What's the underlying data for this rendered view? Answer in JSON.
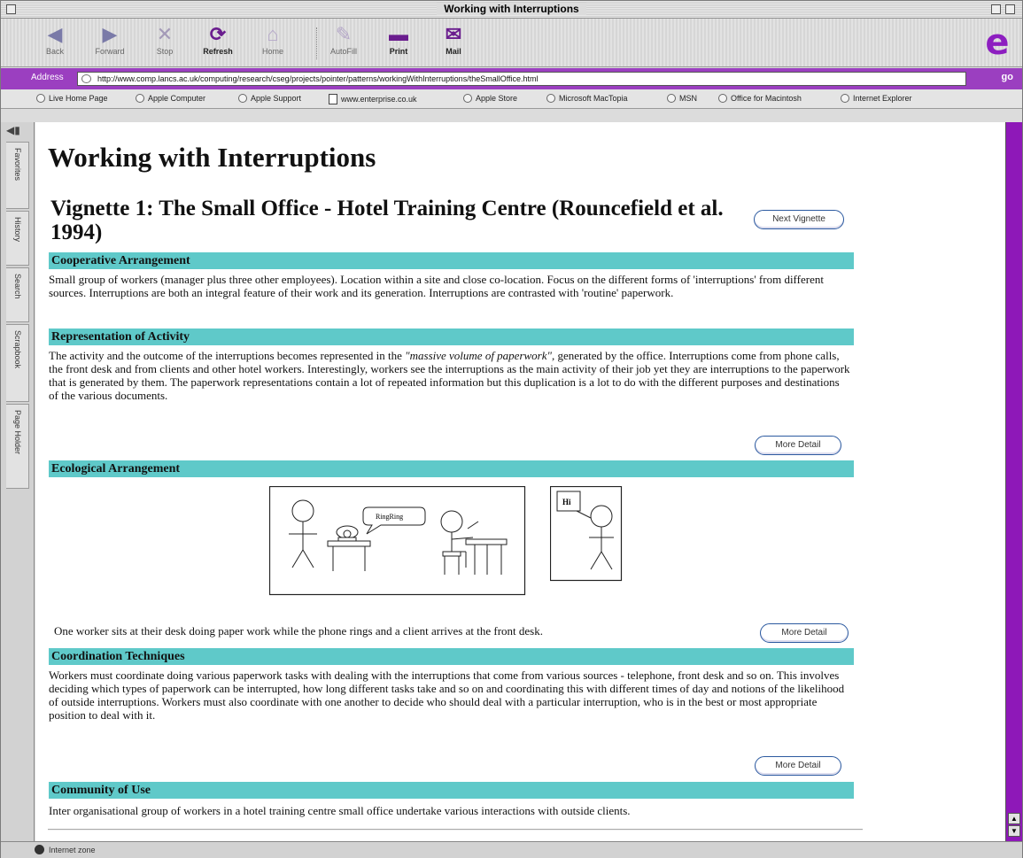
{
  "window": {
    "title": "Working with Interruptions"
  },
  "toolbar": {
    "buttons": [
      {
        "label": "Back",
        "icon": "back-arrow-icon"
      },
      {
        "label": "Forward",
        "icon": "forward-arrow-icon"
      },
      {
        "label": "Stop",
        "icon": "stop-icon"
      },
      {
        "label": "Refresh",
        "icon": "refresh-icon"
      },
      {
        "label": "Home",
        "icon": "home-icon"
      },
      {
        "label": "AutoFill",
        "icon": "autofill-icon"
      },
      {
        "label": "Print",
        "icon": "print-icon"
      },
      {
        "label": "Mail",
        "icon": "mail-icon"
      }
    ],
    "glyphs": {
      "back": "◀",
      "forward": "▶",
      "stop": "✕",
      "refresh": "⟳",
      "home": "⌂",
      "autofill": "✎",
      "print": "▬",
      "mail": "✉",
      "ie": "e"
    }
  },
  "address": {
    "label": "Address",
    "url": "http://www.comp.lancs.ac.uk/computing/research/cseg/projects/pointer/patterns/workingWithInterruptions/theSmallOffice.html",
    "go": "go"
  },
  "favorites": [
    {
      "label": "Live Home Page",
      "type": "site"
    },
    {
      "label": "Apple Computer",
      "type": "site"
    },
    {
      "label": "Apple Support",
      "type": "site"
    },
    {
      "label": "www.enterprise.co.uk",
      "type": "doc"
    },
    {
      "label": "Apple Store",
      "type": "site"
    },
    {
      "label": "Microsoft MacTopia",
      "type": "site"
    },
    {
      "label": "MSN",
      "type": "site"
    },
    {
      "label": "Office for Macintosh",
      "type": "site"
    },
    {
      "label": "Internet Explorer",
      "type": "site"
    }
  ],
  "sidetabs": [
    "Favorites",
    "History",
    "Search",
    "Scrapbook",
    "Page Holder"
  ],
  "page": {
    "title": "Working with Interruptions",
    "vignette_title": "Vignette 1: The Small Office - Hotel Training Centre (Rouncefield et al. 1994)",
    "next_vignette": "Next Vignette",
    "more_detail": "More Detail",
    "sections": {
      "cooperative": {
        "heading": "Cooperative Arrangement",
        "text": "Small group of workers (manager plus three other employees). Location within a site and close co-location. Focus on the different forms of 'interruptions' from different sources. Interruptions are both an integral feature of their work and its generation. Interruptions are contrasted with 'routine' paperwork."
      },
      "representation": {
        "heading": "Representation of Activity",
        "text_before": "The activity and the outcome of the interruptions becomes represented in the ",
        "text_emph": "\"massive volume of paperwork\"",
        "text_after": ", generated by the office. Interruptions come from phone calls, the front desk and from clients and other hotel workers. Interestingly, workers see the interruptions as the main activity of their job yet they are interruptions to the paperwork that is generated by them. The paperwork representations contain a lot of repeated information but this duplication is a lot to do with the different purposes and destinations of the various documents."
      },
      "ecological": {
        "heading": "Ecological Arrangement",
        "bubble_ring": "RingRing",
        "bubble_hi": "Hi",
        "caption": "One worker sits at their desk doing paper work while the phone rings and a client arrives at the front desk."
      },
      "coordination": {
        "heading": "Coordination Techniques",
        "text": "Workers must coordinate doing various paperwork tasks with dealing with the interruptions that come from various sources - telephone, front desk and so on. This involves deciding which types of paperwork can be interrupted, how long different tasks take and so on and coordinating this with different times of day and notions of the likelihood of outside interruptions. Workers must also coordinate with one another to decide who should deal with a particular interruption, who is in the best or most appropriate position to deal with it."
      },
      "community": {
        "heading": "Community of Use",
        "text": "Inter organisational group of workers in a hotel training centre small office undertake various interactions with outside clients."
      }
    }
  },
  "status": {
    "text": "Internet zone"
  },
  "colors": {
    "section_bar": "#5fc9c9",
    "ie_purple": "#9b3fc0",
    "scrollbar_purple": "#8e18b8"
  }
}
